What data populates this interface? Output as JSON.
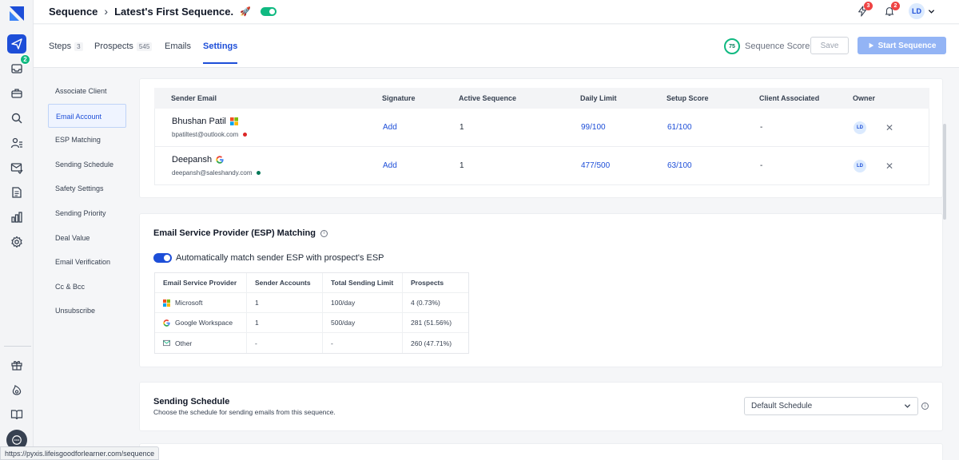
{
  "header": {
    "breadcrumb_root": "Sequence",
    "sequence_name": "Latest's First Sequence.",
    "notif_count_1": "3",
    "notif_count_2": "2",
    "avatar_initials": "LD"
  },
  "rail": {
    "inbox_badge": "2"
  },
  "tabs": [
    {
      "label": "Steps",
      "count": "3"
    },
    {
      "label": "Prospects",
      "count": "545"
    },
    {
      "label": "Emails"
    },
    {
      "label": "Settings"
    }
  ],
  "actions": {
    "score_value": "75",
    "score_label": "Sequence Score",
    "save_label": "Save",
    "start_label": "Start Sequence"
  },
  "settings_menu": [
    "Associate Client",
    "Email Account",
    "ESP Matching",
    "Sending Schedule",
    "Safety Settings",
    "Sending Priority",
    "Deal Value",
    "Email Verification",
    "Cc & Bcc",
    "Unsubscribe"
  ],
  "sender_table": {
    "headers": [
      "Sender Email",
      "Signature",
      "Active Sequence",
      "Daily Limit",
      "Setup Score",
      "Client Associated",
      "Owner"
    ],
    "rows": [
      {
        "name": "Bhushan Patil",
        "email": "bpatiltest@outlook.com",
        "signature": "Add",
        "active_sequence": "1",
        "daily_limit": "99/100",
        "setup_score": "61/100",
        "client": "-",
        "owner": "LD",
        "provider_icon": "microsoft-icon",
        "status_color": "#dc2626"
      },
      {
        "name": "Deepansh",
        "email": "deepansh@saleshandy.com",
        "signature": "Add",
        "active_sequence": "1",
        "daily_limit": "477/500",
        "setup_score": "63/100",
        "client": "-",
        "owner": "LD",
        "provider_icon": "google-icon",
        "status_color": "#047857"
      }
    ]
  },
  "esp": {
    "title": "Email Service Provider (ESP) Matching",
    "toggle_label": "Automatically match sender ESP with prospect's ESP",
    "headers": [
      "Email Service Provider",
      "Sender Accounts",
      "Total Sending Limit",
      "Prospects"
    ],
    "rows": [
      {
        "provider": "Microsoft",
        "accounts": "1",
        "limit": "100/day",
        "prospects": "4 (0.73%)",
        "icon": "microsoft-icon"
      },
      {
        "provider": "Google Workspace",
        "accounts": "1",
        "limit": "500/day",
        "prospects": "281 (51.56%)",
        "icon": "google-icon"
      },
      {
        "provider": "Other",
        "accounts": "-",
        "limit": "-",
        "prospects": "260 (47.71%)",
        "icon": "mail-icon"
      }
    ]
  },
  "schedule": {
    "title": "Sending Schedule",
    "description": "Choose the schedule for sending emails from this sequence.",
    "selected": "Default Schedule"
  },
  "status_url": "https://pyxis.lifeisgoodforlearner.com/sequence"
}
